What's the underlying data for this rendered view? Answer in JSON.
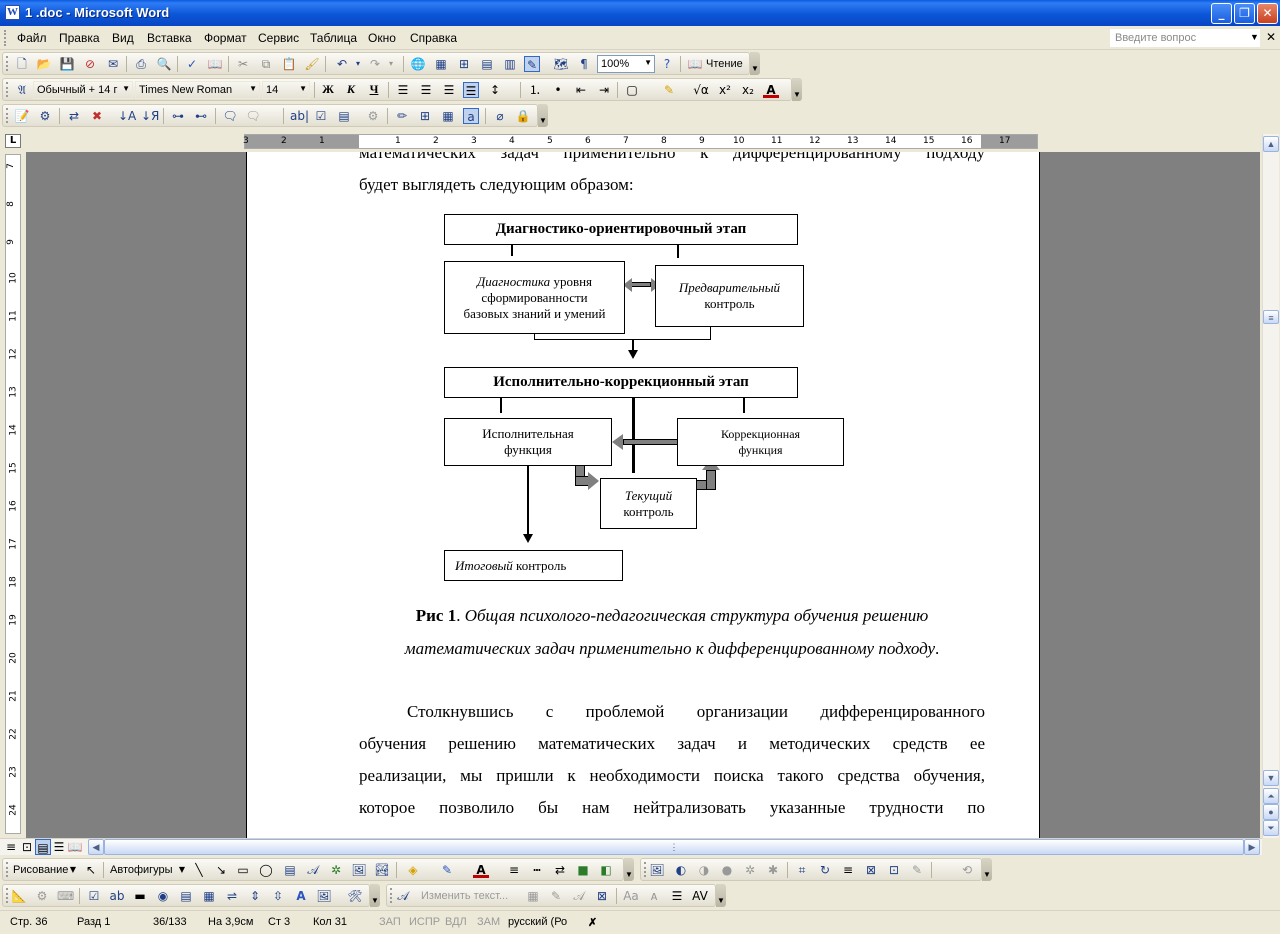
{
  "window": {
    "title": "1 .doc - Microsoft Word",
    "minimize": "_",
    "maximize": "❐",
    "close": "✕"
  },
  "menu": {
    "items": [
      "Файл",
      "Правка",
      "Вид",
      "Вставка",
      "Формат",
      "Сервис",
      "Таблица",
      "Окно",
      "Справка"
    ],
    "help_placeholder": "Введите вопрос"
  },
  "toolbar": {
    "zoom": "100%",
    "read_label": "Чтение",
    "style": "Обычный + 14 г",
    "font": "Times New Roman",
    "font_size": "14",
    "bold": "Ж",
    "italic": "К",
    "underline": "Ч"
  },
  "ruler": {
    "corner": "L",
    "h_numbers": [
      "3",
      "2",
      "1",
      "1",
      "2",
      "3",
      "4",
      "5",
      "6",
      "7",
      "8",
      "9",
      "10",
      "11",
      "12",
      "13",
      "14",
      "15",
      "16",
      "17"
    ],
    "v_numbers": [
      "7",
      "8",
      "9",
      "10",
      "11",
      "12",
      "13",
      "14",
      "15",
      "16",
      "17",
      "18",
      "19",
      "20",
      "21",
      "22",
      "23",
      "24"
    ]
  },
  "document": {
    "para1_line1": "математических задач применительно к дифференцированному подходу",
    "para1_line2": "будет выглядеть следующим образом:",
    "diagram": {
      "stage1": "Диагностико-ориентировочный этап",
      "diag_italic": "Диагностика",
      "diag_rest1": " уровня",
      "diag_rest2": "сформированности",
      "diag_rest3": "базовых знаний и умений",
      "prelim_italic": "Предварительный",
      "prelim_rest": "контроль",
      "stage2": "Исполнительно-коррекционный этап",
      "exec_line1": "Исполнительная",
      "exec_line2": "функция",
      "corr_line1": "Коррекционная",
      "corr_line2": "функция",
      "current_italic": "Текущий",
      "current_rest": "контроль",
      "final_italic": "Итоговый",
      "final_rest": " контроль"
    },
    "caption_bold": "Рис 1",
    "caption_dot": ". ",
    "caption_italic1": "Общая психолого-педагогическая структура обучения решению",
    "caption_italic2": "математических задач применительно к дифференцированному подходу",
    "caption_end": ".",
    "para2_line1": "Столкнувшись с  проблемой организации дифференцированного",
    "para2_line2": "обучения решению математических задач и методических средств ее",
    "para2_line3": "реализации, мы пришли к необходимости поиска такого средства обучения,",
    "para2_line4": "которое позволило бы нам нейтрализовать указанные трудности по"
  },
  "drawing_toolbar": {
    "drawing": "Рисование",
    "autoshapes": "Автофигуры",
    "change_text": "Изменить текст..."
  },
  "status": {
    "page": "Стр.  36",
    "section": "Разд  1",
    "pages": "36/133",
    "at": "На 3,9см",
    "line": "Ст  3",
    "col": "Кол  31",
    "rec": "ЗАП",
    "trk": "ИСПР",
    "ext": "ВДЛ",
    "ovr": "ЗАМ",
    "lang": "русский (Ро"
  }
}
